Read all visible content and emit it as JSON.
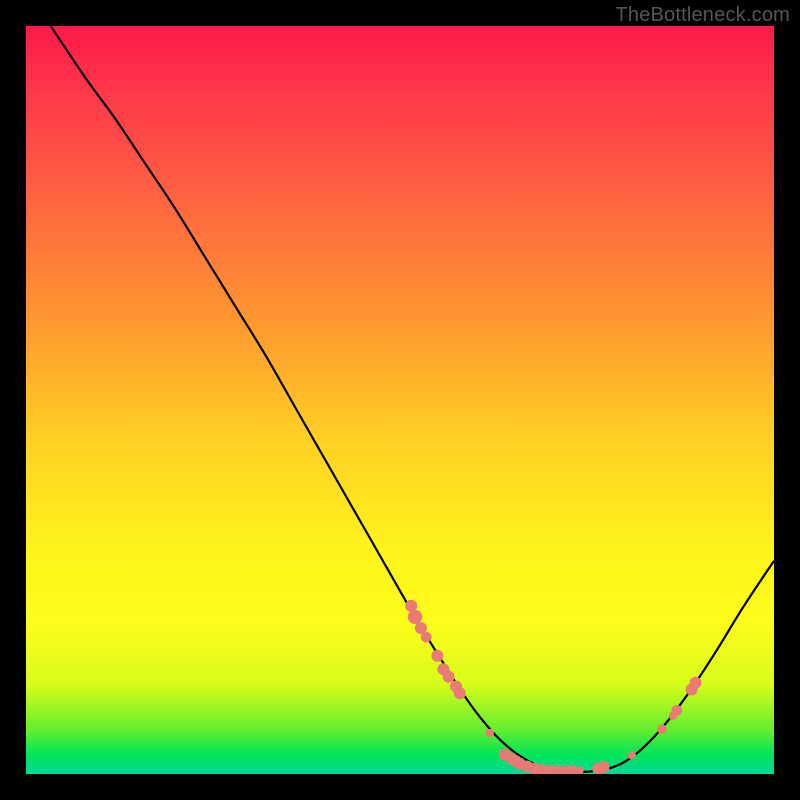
{
  "watermark": "TheBottleneck.com",
  "chart_data": {
    "type": "line",
    "title": "",
    "xlabel": "",
    "ylabel": "",
    "xlim": [
      0,
      100
    ],
    "ylim": [
      0,
      100
    ],
    "curve": {
      "name": "bottleneck-curve",
      "x": [
        3.3,
        8,
        12,
        16,
        20,
        24,
        28,
        32,
        36,
        40,
        44,
        48,
        52,
        56,
        60,
        64,
        68,
        72,
        76,
        80,
        84,
        88,
        92,
        96,
        100
      ],
      "y": [
        100,
        93,
        87.5,
        81.5,
        75.5,
        69,
        62.5,
        56,
        49,
        42,
        35,
        28,
        21,
        14.5,
        8.5,
        4,
        1.3,
        0.4,
        0.4,
        1.6,
        5,
        10,
        16,
        22.5,
        28.5
      ]
    },
    "markers": {
      "name": "highlighted-points",
      "points": [
        {
          "x": 51.5,
          "y": 22.5,
          "r": 1.0
        },
        {
          "x": 52.0,
          "y": 21.0,
          "r": 1.2
        },
        {
          "x": 52.8,
          "y": 19.5,
          "r": 1.0
        },
        {
          "x": 53.5,
          "y": 18.3,
          "r": 0.9
        },
        {
          "x": 55.0,
          "y": 15.8,
          "r": 1.0
        },
        {
          "x": 55.8,
          "y": 14.0,
          "r": 1.0
        },
        {
          "x": 56.5,
          "y": 13.0,
          "r": 1.0
        },
        {
          "x": 57.5,
          "y": 11.7,
          "r": 1.0
        },
        {
          "x": 58.0,
          "y": 10.8,
          "r": 1.0
        },
        {
          "x": 62.0,
          "y": 5.5,
          "r": 0.7
        },
        {
          "x": 64.0,
          "y": 2.6,
          "r": 1.0
        },
        {
          "x": 65.0,
          "y": 2.0,
          "r": 1.0
        },
        {
          "x": 65.5,
          "y": 1.7,
          "r": 1.0
        },
        {
          "x": 66.0,
          "y": 1.4,
          "r": 1.0
        },
        {
          "x": 67.0,
          "y": 1.0,
          "r": 1.0
        },
        {
          "x": 68.0,
          "y": 0.7,
          "r": 1.0
        },
        {
          "x": 69.0,
          "y": 0.5,
          "r": 1.0
        },
        {
          "x": 70.0,
          "y": 0.4,
          "r": 1.0
        },
        {
          "x": 71.0,
          "y": 0.35,
          "r": 1.0
        },
        {
          "x": 72.0,
          "y": 0.35,
          "r": 1.0
        },
        {
          "x": 73.0,
          "y": 0.4,
          "r": 1.0
        },
        {
          "x": 74.0,
          "y": 0.45,
          "r": 0.7
        },
        {
          "x": 76.5,
          "y": 0.7,
          "r": 1.0
        },
        {
          "x": 77.2,
          "y": 0.9,
          "r": 1.0
        },
        {
          "x": 81.0,
          "y": 2.5,
          "r": 0.7
        },
        {
          "x": 85.0,
          "y": 6.0,
          "r": 0.8
        },
        {
          "x": 86.5,
          "y": 7.8,
          "r": 0.7
        },
        {
          "x": 87.0,
          "y": 8.5,
          "r": 0.9
        },
        {
          "x": 89.0,
          "y": 11.3,
          "r": 1.0
        },
        {
          "x": 89.5,
          "y": 12.2,
          "r": 1.0
        }
      ]
    },
    "gradient_stops": [
      {
        "pos": 0.0,
        "color": "#ff1a4a"
      },
      {
        "pos": 0.25,
        "color": "#ff6a3f"
      },
      {
        "pos": 0.55,
        "color": "#ffcf24"
      },
      {
        "pos": 0.8,
        "color": "#fdfd1a"
      },
      {
        "pos": 0.975,
        "color": "#00e45a"
      },
      {
        "pos": 1.0,
        "color": "#00d89a"
      }
    ],
    "marker_color": "#e97b75"
  }
}
